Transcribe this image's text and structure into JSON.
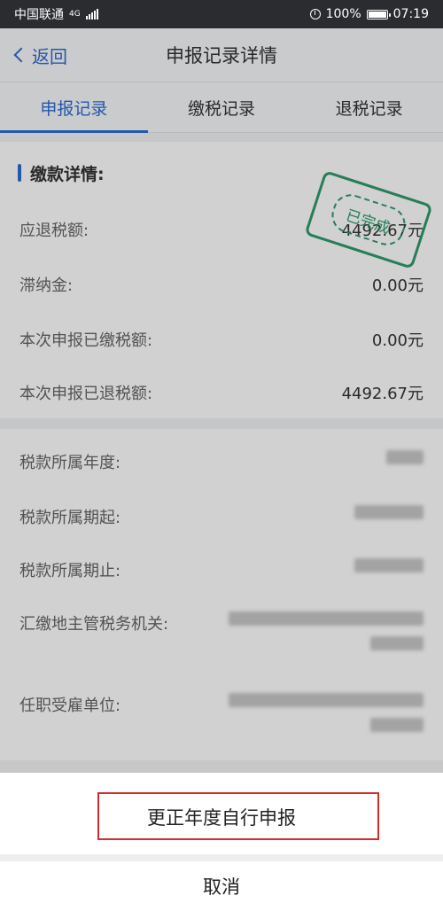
{
  "status": {
    "carrier": "中国联通",
    "network": "4G",
    "battery": "100%",
    "time": "07:19"
  },
  "nav": {
    "back": "返回",
    "title": "申报记录详情"
  },
  "tabs": [
    {
      "label": "申报记录",
      "active": true
    },
    {
      "label": "缴税记录",
      "active": false
    },
    {
      "label": "退税记录",
      "active": false
    }
  ],
  "payment": {
    "title": "缴款详情:",
    "rows": [
      {
        "label": "应退税额:",
        "value": "4492.67元"
      },
      {
        "label": "滞纳金:",
        "value": "0.00元"
      },
      {
        "label": "本次申报已缴税额:",
        "value": "0.00元"
      },
      {
        "label": "本次申报已退税额:",
        "value": "4492.67元"
      }
    ],
    "stamp": "已完成"
  },
  "details": {
    "rows": [
      {
        "label": "税款所属年度:"
      },
      {
        "label": "税款所属期起:"
      },
      {
        "label": "税款所属期止:"
      },
      {
        "label": "汇缴地主管税务机关:"
      },
      {
        "label": "任职受雇单位:"
      }
    ]
  },
  "sheet": {
    "primary": "更正年度自行申报",
    "cancel": "取消"
  },
  "colors": {
    "accent": "#2e6bd1",
    "stamp": "#2f9a6b",
    "highlight": "#d32c2c"
  }
}
